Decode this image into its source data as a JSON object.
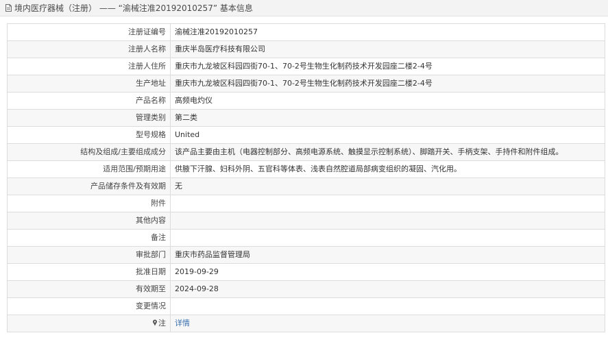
{
  "header": {
    "icon": "document-icon",
    "title": "境内医疗器械（注册） —— “渝械注准20192010257” 基本信息"
  },
  "rows": [
    {
      "label": "注册证编号",
      "value": "渝械注准20192010257"
    },
    {
      "label": "注册人名称",
      "value": "重庆半岛医疗科技有限公司"
    },
    {
      "label": "注册人住所",
      "value": "重庆市九龙坡区科园四街70-1、70-2号生物生化制药技术开发园座二楼2-4号"
    },
    {
      "label": "生产地址",
      "value": "重庆市九龙坡区科园四街70-1、70-2号生物生化制药技术开发园座二楼2-4号"
    },
    {
      "label": "产品名称",
      "value": "高频电灼仪"
    },
    {
      "label": "管理类别",
      "value": "第二类"
    },
    {
      "label": "型号规格",
      "value": "United"
    },
    {
      "label": "结构及组成/主要组成成分",
      "value": "该产品主要由主机（电器控制部分、高频电源系统、触摸显示控制系统）、脚踏开关、手柄支架、手持件和附件组成。"
    },
    {
      "label": "适用范围/预期用途",
      "value": "供腋下汗腺、妇科外阴、五官科等体表、浅表自然腔道局部病变组织的凝固、汽化用。"
    },
    {
      "label": "产品储存条件及有效期",
      "value": "无"
    },
    {
      "label": "附件",
      "value": ""
    },
    {
      "label": "其他内容",
      "value": ""
    },
    {
      "label": "备注",
      "value": ""
    },
    {
      "label": "审批部门",
      "value": "重庆市药品监督管理局"
    },
    {
      "label": "批准日期",
      "value": "2019-09-29"
    },
    {
      "label": "有效期至",
      "value": "2024-09-28"
    },
    {
      "label": "变更情况",
      "value": ""
    }
  ],
  "note_row": {
    "icon": "pin-icon",
    "label": "注",
    "link_text": "详情"
  },
  "colors": {
    "header_bg": "#f3f3f3",
    "border": "#dcdcdc",
    "alt_row": "#f7f7f7",
    "link": "#3a6fb0"
  }
}
